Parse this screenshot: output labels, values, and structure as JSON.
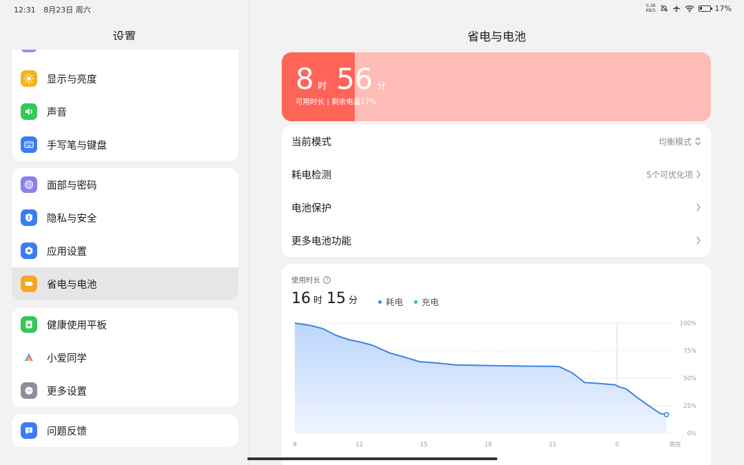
{
  "status_bar": {
    "time": "12:31",
    "date": "8月23日 周六",
    "net_speed_value": "0.38",
    "net_speed_unit": "KB/S",
    "battery_percent": "17%"
  },
  "left": {
    "title": "设置",
    "groups": [
      [
        {
          "label": "显示与亮度",
          "icon": "brightness-icon",
          "color": "#f5b41e"
        },
        {
          "label": "声音",
          "icon": "speaker-icon",
          "color": "#34c759"
        },
        {
          "label": "手写笔与键盘",
          "icon": "keyboard-icon",
          "color": "#3b7cf5"
        }
      ],
      [
        {
          "label": "面部与密码",
          "icon": "face-id-icon",
          "color": "#8b7ff0"
        },
        {
          "label": "隐私与安全",
          "icon": "shield-icon",
          "color": "#3b7cf5"
        },
        {
          "label": "应用设置",
          "icon": "app-settings-icon",
          "color": "#3b7cf5"
        },
        {
          "label": "省电与电池",
          "icon": "battery-icon",
          "color": "#f5a623",
          "selected": true
        }
      ],
      [
        {
          "label": "健康使用平板",
          "icon": "health-icon",
          "color": "#34c759"
        },
        {
          "label": "小爱同学",
          "icon": "xiaoai-icon",
          "color": "#ffffff"
        },
        {
          "label": "更多设置",
          "icon": "more-icon",
          "color": "#8e8e9a"
        }
      ],
      [
        {
          "label": "问题反馈",
          "icon": "feedback-icon",
          "color": "#3b7cf5"
        }
      ]
    ]
  },
  "right": {
    "title": "省电与电池",
    "battery": {
      "hours": "8",
      "hours_unit": "时",
      "minutes": "56",
      "minutes_unit": "分",
      "subtitle": "可用时长 | 剩余电量17%",
      "level": 0.17,
      "color_used": "#ff6458",
      "color_remaining": "#ffbcb6"
    },
    "rows": [
      {
        "label": "当前模式",
        "value": "均衡模式",
        "chevron": "updown"
      },
      {
        "label": "耗电检测",
        "value": "5个可优化项",
        "chevron": "right"
      },
      {
        "label": "电池保护",
        "value": "",
        "chevron": "right"
      },
      {
        "label": "更多电池功能",
        "value": "",
        "chevron": "right"
      }
    ],
    "usage": {
      "label": "使用时长",
      "hours": "16",
      "hours_unit": "时",
      "minutes": "15",
      "minutes_unit": "分",
      "legend": [
        {
          "name": "耗电",
          "color": "#3b82e8"
        },
        {
          "name": "充电",
          "color": "#34c759"
        }
      ]
    }
  },
  "chart_data": {
    "type": "area",
    "series": [
      {
        "name": "耗电",
        "color": "#3b82e8",
        "points": [
          [
            9.0,
            100
          ],
          [
            9.7,
            98
          ],
          [
            10.3,
            95
          ],
          [
            10.9,
            89
          ],
          [
            11.5,
            85
          ],
          [
            12.0,
            83
          ],
          [
            12.6,
            80
          ],
          [
            13.4,
            73
          ],
          [
            14.3,
            68
          ],
          [
            14.8,
            65
          ],
          [
            15.5,
            64
          ],
          [
            16.5,
            62
          ],
          [
            18.0,
            61.5
          ],
          [
            19.5,
            61
          ],
          [
            21.0,
            60.8
          ],
          [
            21.3,
            60.5
          ],
          [
            21.9,
            55
          ],
          [
            22.5,
            46
          ],
          [
            23.0,
            45.5
          ],
          [
            23.9,
            44
          ],
          [
            24.1,
            42
          ],
          [
            24.4,
            40.5
          ],
          [
            24.9,
            33
          ],
          [
            25.4,
            26
          ],
          [
            26.0,
            18
          ],
          [
            26.3,
            17
          ]
        ]
      }
    ],
    "x_ticks": [
      {
        "value": 9,
        "label": "9"
      },
      {
        "value": 12,
        "label": "12"
      },
      {
        "value": 15,
        "label": "15"
      },
      {
        "value": 18,
        "label": "18"
      },
      {
        "value": 21,
        "label": "21"
      },
      {
        "value": 24,
        "label": "0"
      },
      {
        "value": 26.7,
        "label": "现在"
      }
    ],
    "y_ticks": [
      {
        "value": 100,
        "label": "100%"
      },
      {
        "value": 75,
        "label": "75%"
      },
      {
        "value": 50,
        "label": "50%"
      },
      {
        "value": 25,
        "label": "25%"
      },
      {
        "value": 0,
        "label": "0%"
      }
    ],
    "xlim": [
      9,
      26.7
    ],
    "ylim": [
      0,
      100
    ],
    "day_divider_at": 24,
    "grid": true
  }
}
